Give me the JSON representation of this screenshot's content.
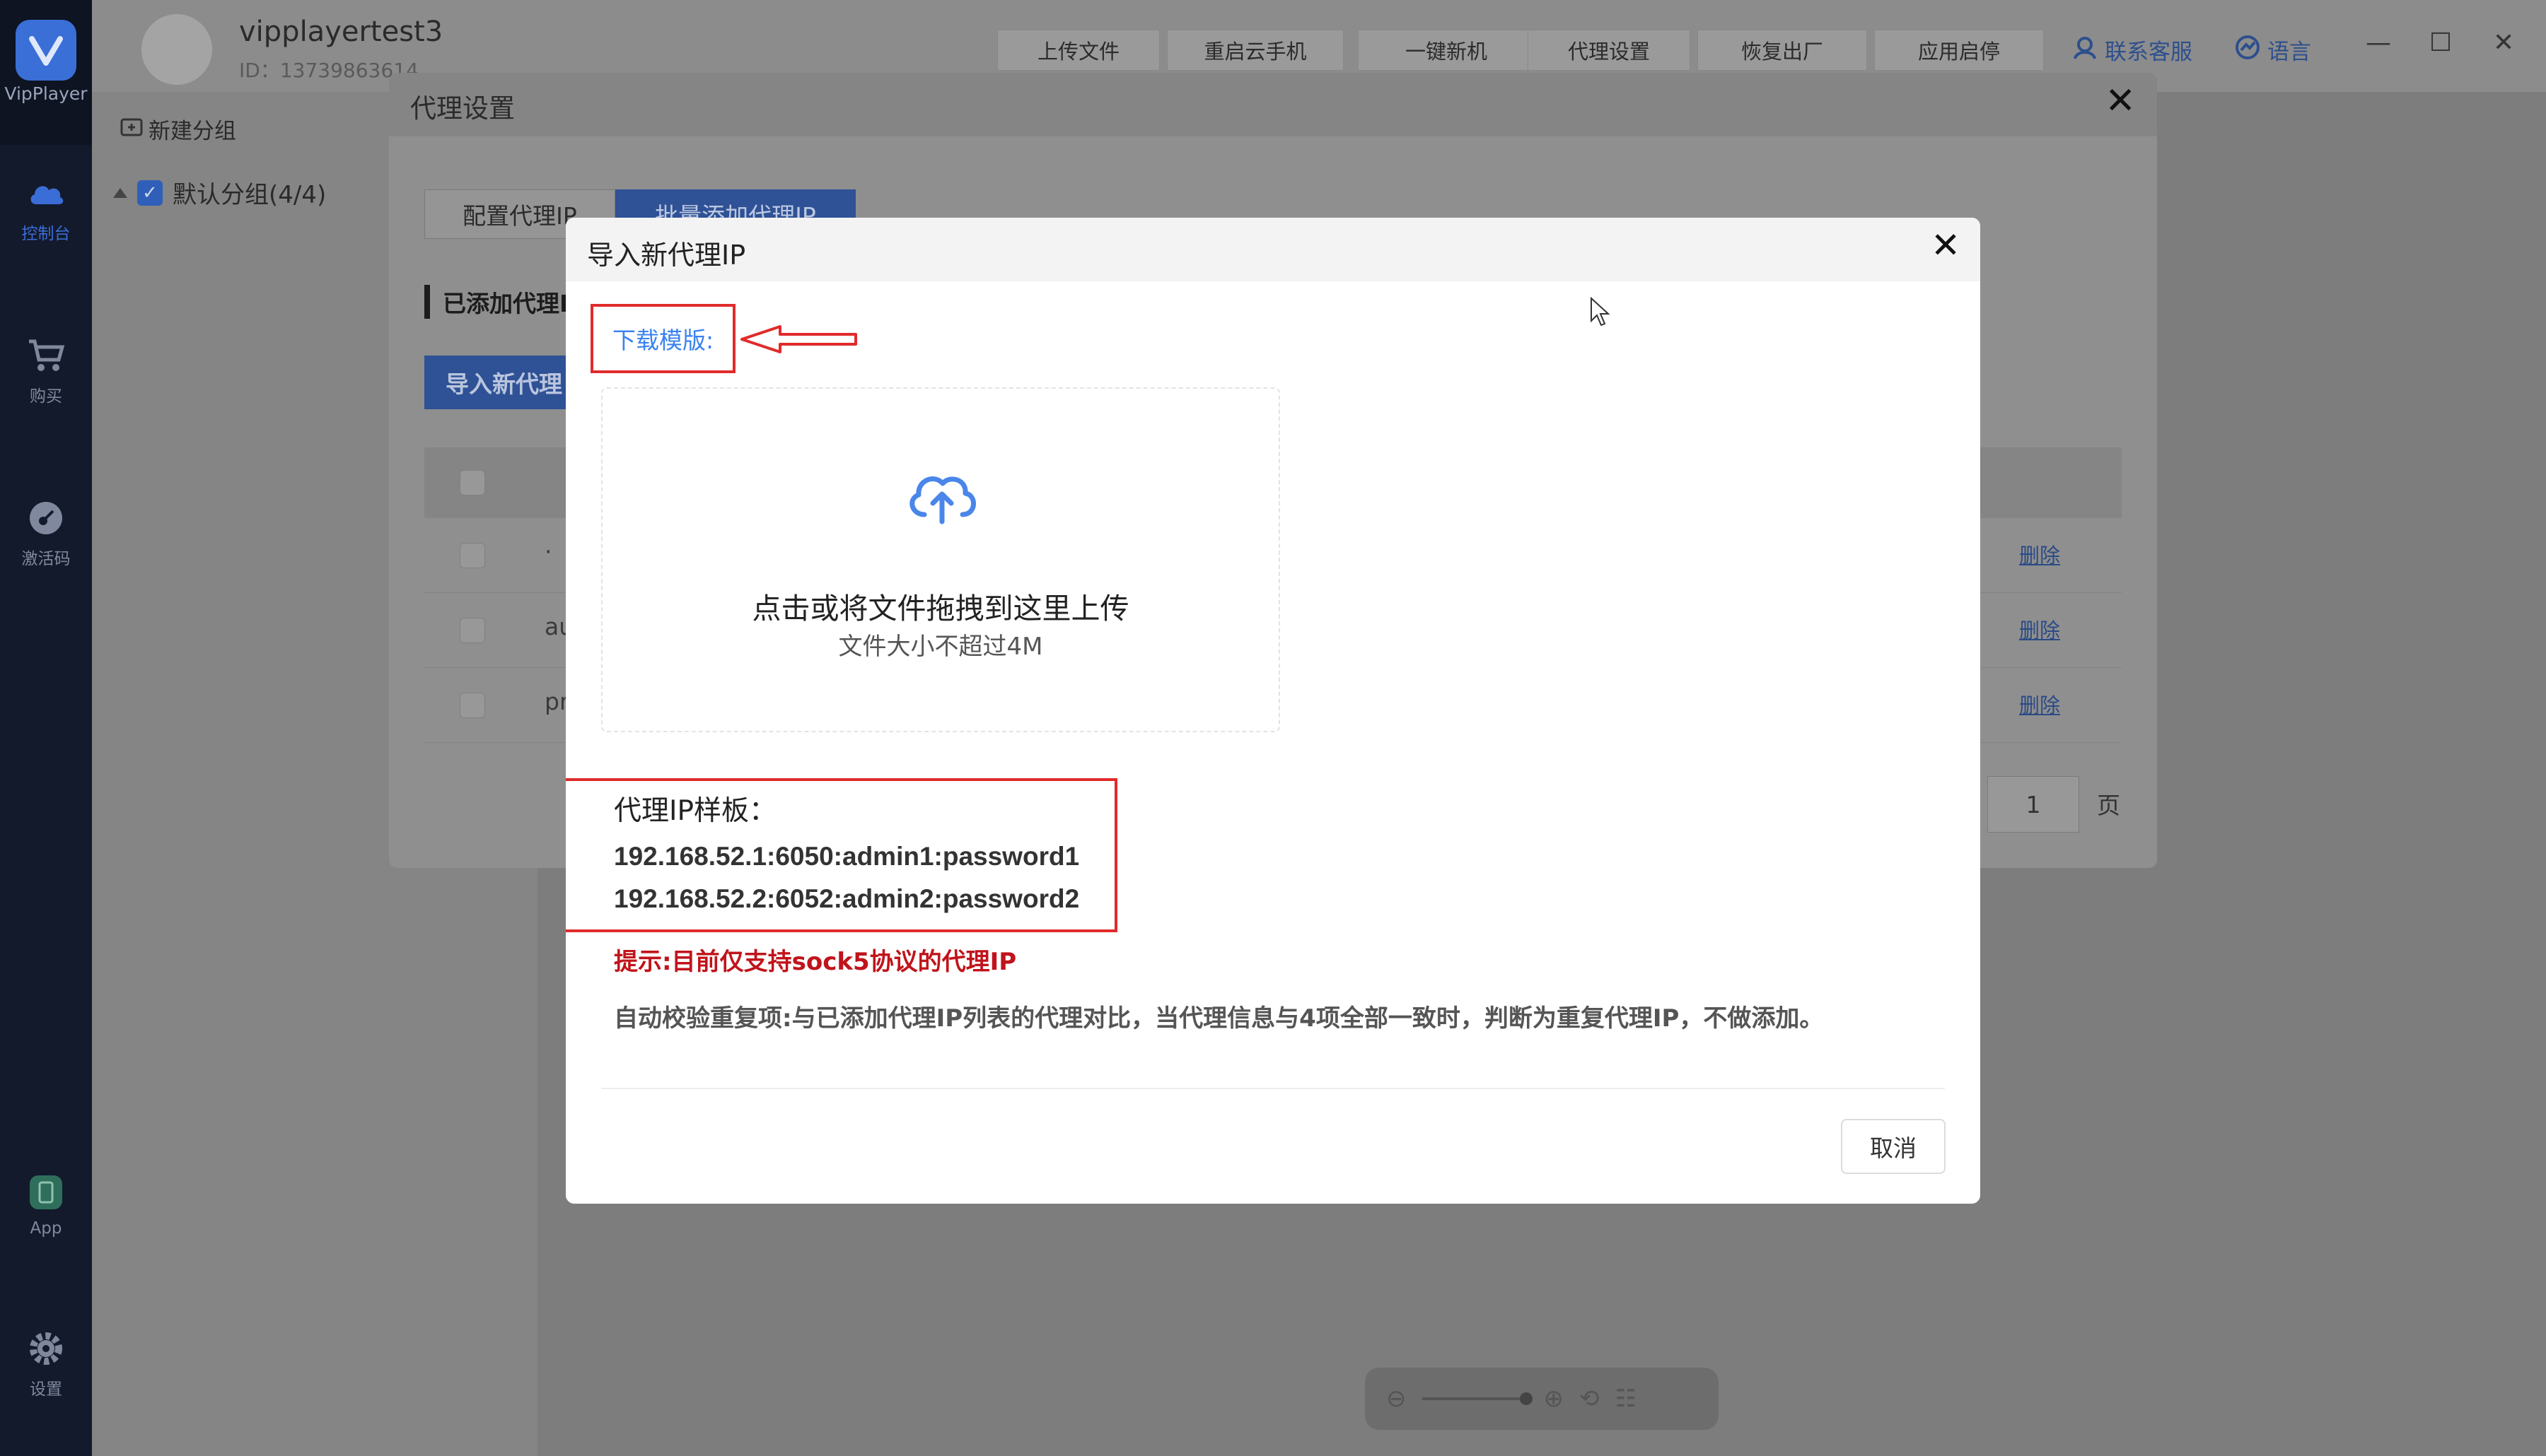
{
  "app": {
    "name": "VipPlayer",
    "username": "vipplayertest3",
    "user_id": "ID：13739863614"
  },
  "sidebar": {
    "items": [
      {
        "label": "控制台",
        "icon": "cloud-icon"
      },
      {
        "label": "购买",
        "icon": "cart-icon"
      },
      {
        "label": "激活码",
        "icon": "key-icon"
      },
      {
        "label": "App",
        "icon": "phone-icon"
      },
      {
        "label": "设置",
        "icon": "gear-icon"
      }
    ]
  },
  "toolbar": {
    "buttons": [
      "上传文件",
      "重启云手机",
      "一键新机",
      "代理设置",
      "恢复出厂",
      "应用启停"
    ],
    "contact": "联系客服",
    "language": "语言"
  },
  "groups": {
    "new_group": "新建分组",
    "default_group": "默认分组(4/4)"
  },
  "proxy_dialog": {
    "title": "代理设置",
    "tabs": [
      "配置代理IP",
      "批量添加代理IP"
    ],
    "section": "已添加代理I",
    "import_button": "导入新代理",
    "rows": [
      {
        "cell": "·",
        "action": "删除"
      },
      {
        "cell": "au",
        "action": "删除"
      },
      {
        "cell": "pr",
        "action": "删除"
      }
    ],
    "page_number": "1",
    "page_unit": "页"
  },
  "import_dialog": {
    "title": "导入新代理IP",
    "download_template": "下载模版:",
    "upload_main": "点击或将文件拖拽到这里上传",
    "upload_sub": "文件大小不超过4M",
    "sample_title": "代理IP样板：",
    "sample_lines": [
      "192.168.52.1:6050:admin1:password1",
      "192.168.52.2:6052:admin2:password2"
    ],
    "hint_red": "提示:目前仅支持sock5协议的代理IP",
    "hint_gray": "自动校验重复项:与已添加代理IP列表的代理对比，当代理信息与4项全部一致时，判断为重复代理IP，不做添加。",
    "cancel": "取消"
  },
  "colors": {
    "accent": "#3b82f0",
    "annotation_red": "#e02b2b",
    "hint_red": "#c0141b",
    "sidebar_bg": "#131a2c"
  }
}
